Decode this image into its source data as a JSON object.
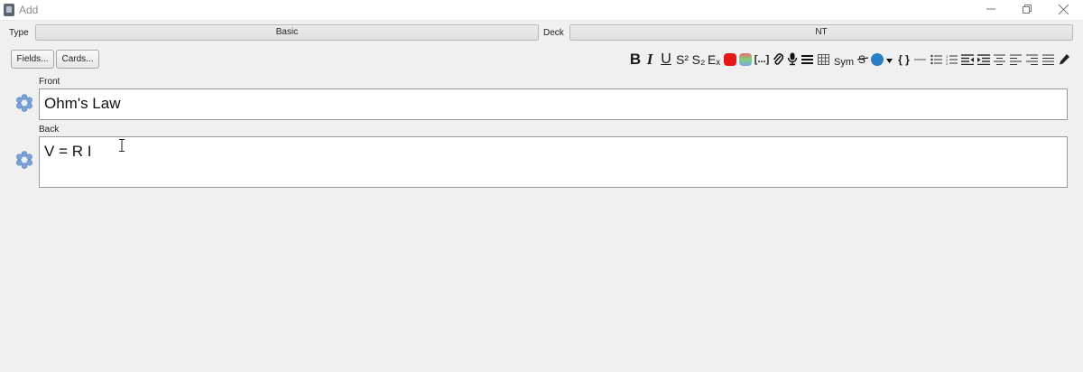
{
  "window": {
    "title": "Add"
  },
  "type_row": {
    "type_label": "Type",
    "type_value": "Basic",
    "deck_label": "Deck",
    "deck_value": "NT"
  },
  "buttons": {
    "fields": "Fields...",
    "cards": "Cards..."
  },
  "toolbar": {
    "bold": "B",
    "italic": "I",
    "underline": "U",
    "superscript": "S²",
    "subscript": "S₂",
    "clear_format": "Eₓ",
    "cloze": "[...]",
    "symbols": "Sym",
    "mathjax": "{ }",
    "text_color": "#e81717",
    "highlight_colors": [
      "#e86c6c",
      "#7ed37e",
      "#7aa7e8"
    ],
    "background_color": "#2b7fc4",
    "icons": [
      "bold-icon",
      "italic-icon",
      "underline-icon",
      "superscript-icon",
      "subscript-icon",
      "clear-format-icon",
      "text-color-icon",
      "highlight-color-icon",
      "cloze-icon",
      "attach-icon",
      "record-audio-icon",
      "html-editor-icon",
      "table-icon",
      "symbols-icon",
      "strikethrough-icon",
      "background-color-icon",
      "mathjax-icon",
      "horizontal-rule-icon",
      "bullet-list-icon",
      "numbered-list-icon",
      "outdent-icon",
      "indent-icon",
      "align-center-icon",
      "align-left-icon",
      "align-right-icon",
      "justify-icon",
      "pencil-icon"
    ]
  },
  "fields": [
    {
      "label": "Front",
      "value": "Ohm's Law"
    },
    {
      "label": "Back",
      "value": "V = R I"
    }
  ]
}
